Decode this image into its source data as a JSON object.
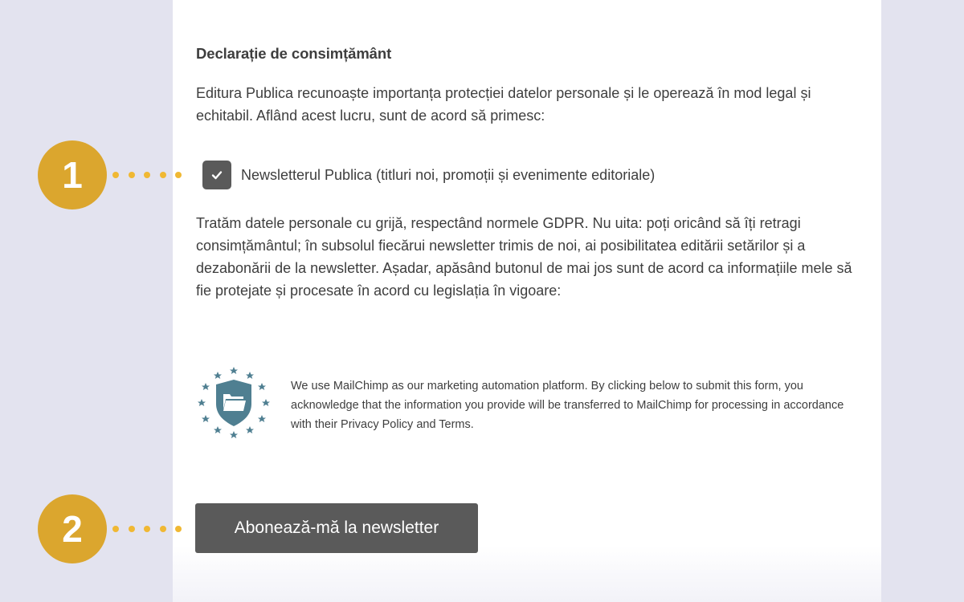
{
  "form": {
    "heading": "Declarație de consimțământ",
    "intro": "Editura Publica recunoaște importanța protecției datelor personale și le operează în mod legal și echitabil. Aflând acest lucru, sunt de acord să primesc:",
    "checkbox": {
      "label": "Newsletterul Publica (titluri noi, promoții și evenimente editoriale)",
      "checked": true,
      "icon": "checkmark-icon"
    },
    "gdpr_text": "Tratăm datele personale cu grijă, respectând normele GDPR. Nu uita: poți oricând să îți retragi consimțământul; în subsolul fiecărui newsletter trimis de noi, ai posibilitatea editării setărilor și a dezabonării de la newsletter. Așadar, apăsând butonul de mai jos sunt de acord ca informațiile mele să fie protejate și procesate în acord cu legislația în vigoare:",
    "mailchimp": {
      "icon": "gdpr-shield-icon",
      "text": "We use MailChimp as our marketing automation platform. By clicking below to submit this form, you acknowledge that the information you provide will be transferred to MailChimp for processing in accordance with their Privacy Policy and Terms."
    },
    "submit_label": "Abonează-mă la newsletter"
  },
  "annotations": {
    "step1": "1",
    "step2": "2"
  },
  "colors": {
    "background": "#e3e3ef",
    "panel": "#ffffff",
    "badge": "#dba62e",
    "dots": "#f0b833",
    "button": "#5a5a5a",
    "icon_teal": "#4f7f91",
    "text": "#3e3e3e"
  }
}
